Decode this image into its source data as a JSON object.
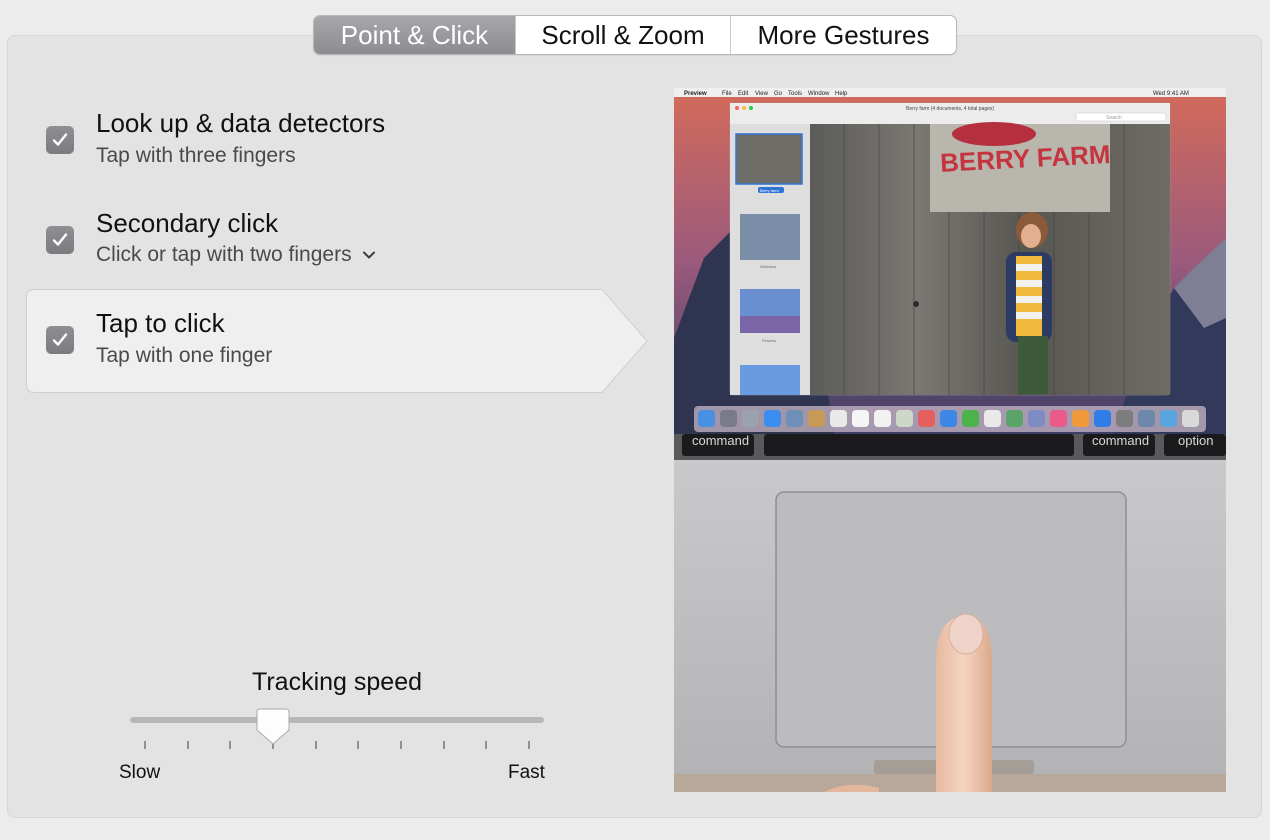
{
  "tabs": [
    {
      "label": "Point & Click",
      "active": true
    },
    {
      "label": "Scroll & Zoom",
      "active": false
    },
    {
      "label": "More Gestures",
      "active": false
    }
  ],
  "options": [
    {
      "title": "Look up & data detectors",
      "subtitle": "Tap with three fingers",
      "checked": true,
      "selected": false,
      "has_dropdown": false
    },
    {
      "title": "Secondary click",
      "subtitle": "Click or tap with two fingers",
      "checked": true,
      "selected": false,
      "has_dropdown": true
    },
    {
      "title": "Tap to click",
      "subtitle": "Tap with one finger",
      "checked": true,
      "selected": true,
      "has_dropdown": false
    }
  ],
  "tracking": {
    "title": "Tracking speed",
    "min_label": "Slow",
    "max_label": "Fast",
    "tick_count": 10,
    "value_step": 3
  },
  "preview": {
    "menu_bar_items": [
      "Preview",
      "File",
      "Edit",
      "View",
      "Go",
      "Tools",
      "Window",
      "Help"
    ],
    "menu_bar_clock": "Wed 9:41 AM",
    "window_title": "Berry farm (4 documents, 4 total pages)",
    "search_placeholder": "Search",
    "sign_text": "BERRY FARM",
    "thumbnails": [
      "Berry farm",
      "Delicious",
      "Flowers"
    ],
    "keys": {
      "left_command": "command",
      "right_command": "command",
      "option": "option"
    }
  },
  "colors": {
    "panel_bg": "#e3e3e3",
    "active_tab": "#8d8d91",
    "checkbox": "#7b7b80",
    "selection_bg": "#efefef"
  }
}
